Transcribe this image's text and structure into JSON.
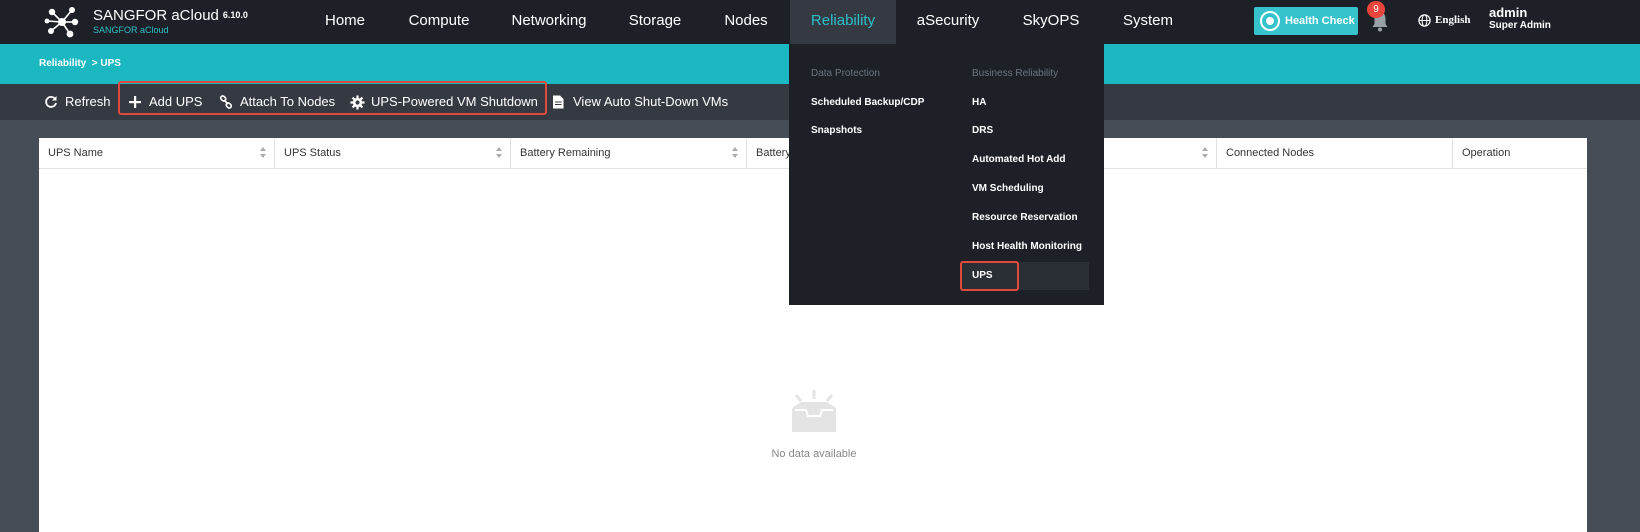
{
  "brand": {
    "name": "SANGFOR aCloud",
    "version": "6.10.0",
    "subtitle": "SANGFOR aCloud"
  },
  "nav": [
    {
      "label": "Home"
    },
    {
      "label": "Compute"
    },
    {
      "label": "Networking"
    },
    {
      "label": "Storage"
    },
    {
      "label": "Nodes"
    },
    {
      "label": "Reliability"
    },
    {
      "label": "aSecurity"
    },
    {
      "label": "SkyOPS"
    },
    {
      "label": "System"
    }
  ],
  "header": {
    "health_check": "Health Check",
    "notifications": "9",
    "language": "English",
    "user": "admin",
    "role": "Super Admin"
  },
  "breadcrumb": "Reliability  > UPS",
  "toolbar": {
    "refresh": "Refresh",
    "add_ups": "Add UPS",
    "attach_nodes": "Attach To Nodes",
    "vm_shutdown": "UPS-Powered VM Shutdown",
    "view_vms": "View Auto Shut-Down VMs"
  },
  "table": {
    "columns": [
      "UPS Name",
      "UPS Status",
      "Battery Remaining",
      "Battery",
      "",
      "Connected Nodes",
      "Operation"
    ],
    "empty_text": "No data available"
  },
  "dropdown": {
    "col1_header": "Data Protection",
    "col1_items": [
      "Scheduled Backup/CDP",
      "Snapshots"
    ],
    "col2_header": "Business Reliability",
    "col2_items": [
      "HA",
      "DRS",
      "Automated Hot Add",
      "VM Scheduling",
      "Resource Reservation",
      "Host Health Monitoring",
      "UPS"
    ]
  },
  "colors": {
    "accent": "#1cb8c1",
    "nav_bg": "#1d2127",
    "highlight": "#e04a3a"
  }
}
